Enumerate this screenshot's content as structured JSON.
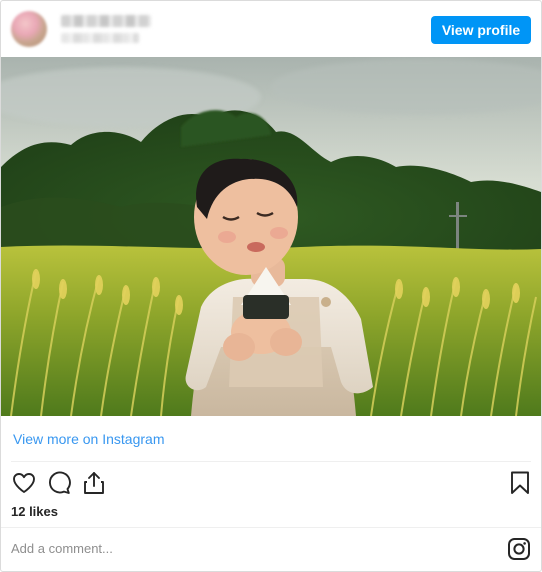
{
  "header": {
    "view_profile_label": "View profile"
  },
  "post": {
    "view_more_label": "View more on Instagram",
    "likes_text": "12 likes",
    "comment_placeholder": "Add a comment..."
  },
  "icons": {
    "like": "heart-icon",
    "comment": "comment-icon",
    "share": "share-icon",
    "save": "bookmark-icon",
    "brand": "instagram-icon"
  },
  "colors": {
    "accent": "#0095f6",
    "link": "#3897f0"
  }
}
